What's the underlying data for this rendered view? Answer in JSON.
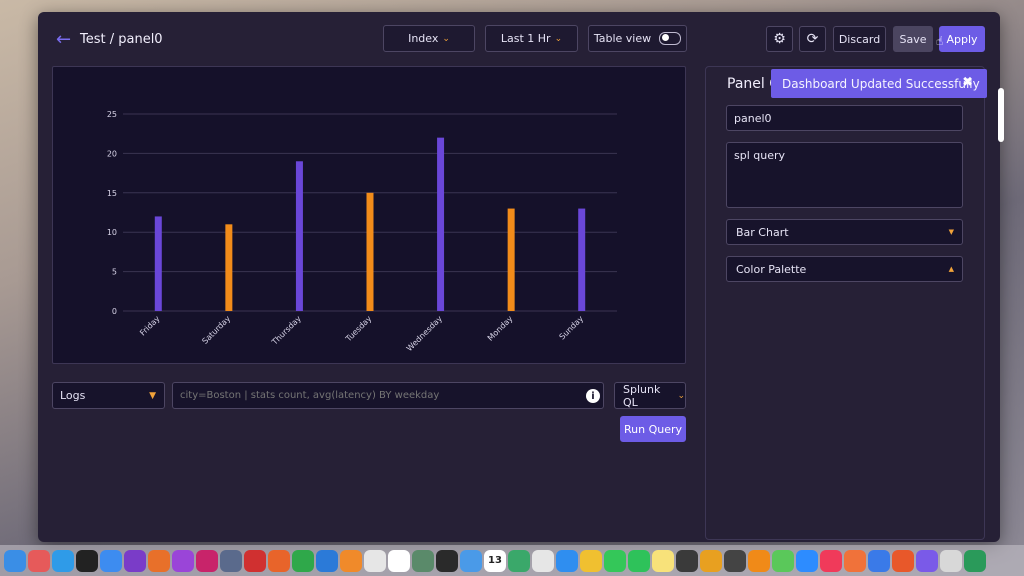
{
  "header": {
    "title": "Test / panel0",
    "index_label": "Index",
    "time_label": "Last 1 Hr",
    "table_view_label": "Table view",
    "discard_label": "Discard",
    "save_label": "Save",
    "apply_label": "Apply"
  },
  "chart_data": {
    "type": "bar",
    "categories": [
      "Friday",
      "Saturday",
      "Thursday",
      "Tuesday",
      "Wednesday",
      "Monday",
      "Sunday"
    ],
    "values": [
      12,
      11,
      19,
      15,
      22,
      13,
      13
    ],
    "bar_colors": [
      "#6a47d8",
      "#f28c1a",
      "#6a47d8",
      "#f28c1a",
      "#6a47d8",
      "#f28c1a",
      "#6a47d8"
    ],
    "yticks": [
      "0",
      "5",
      "10",
      "15",
      "20",
      "25"
    ],
    "ylim": [
      0,
      25
    ],
    "grid": true,
    "title": "",
    "xlabel": "",
    "ylabel": ""
  },
  "query": {
    "source_label": "Logs",
    "placeholder": "city=Boston | stats count, avg(latency) BY weekday",
    "language_label": "Splunk QL",
    "run_label": "Run Query"
  },
  "panel": {
    "title": "Panel C",
    "name_value": "panel0",
    "query_value": "spl query",
    "chart_type_label": "Bar Chart",
    "palette_label": "Color Palette"
  },
  "toast": {
    "message": "Dashboard Updated Successfully"
  },
  "dock": {
    "calendar_day": "13",
    "icons": [
      {
        "name": "finder-icon",
        "color": "#3a8ee6"
      },
      {
        "name": "launchpad-icon",
        "color": "#e65a5a"
      },
      {
        "name": "safari-icon",
        "color": "#2f9be8"
      },
      {
        "name": "appletv-icon",
        "color": "#222222"
      },
      {
        "name": "mail-icon",
        "color": "#3d8cf0"
      },
      {
        "name": "omnifocus-icon",
        "color": "#7a3cc8"
      },
      {
        "name": "jetbrains-icon",
        "color": "#e8702a"
      },
      {
        "name": "stacks-icon",
        "color": "#9a45d8"
      },
      {
        "name": "affinity-icon",
        "color": "#c8246a"
      },
      {
        "name": "disk-icon",
        "color": "#5a6a8c"
      },
      {
        "name": "redapp-icon",
        "color": "#d03030"
      },
      {
        "name": "draw-icon",
        "color": "#e8642a"
      },
      {
        "name": "numbers-icon",
        "color": "#2fa84a"
      },
      {
        "name": "keynote-icon",
        "color": "#2b7ad8"
      },
      {
        "name": "sublime-icon",
        "color": "#f08a2a"
      },
      {
        "name": "preview-icon",
        "color": "#e6e6e6"
      },
      {
        "name": "slack-icon",
        "color": "#ffffff"
      },
      {
        "name": "layers-icon",
        "color": "#5a8a6a"
      },
      {
        "name": "terminal-icon",
        "color": "#2a2a2a"
      },
      {
        "name": "finder2-icon",
        "color": "#4a9ae8"
      },
      {
        "name": "calendar-icon",
        "color": "#ffffff"
      },
      {
        "name": "android-icon",
        "color": "#3aa86a"
      },
      {
        "name": "cloud-icon",
        "color": "#e6e6e6"
      },
      {
        "name": "appstore-icon",
        "color": "#2f8ef0"
      },
      {
        "name": "photos-icon",
        "color": "#f0c030"
      },
      {
        "name": "messages-icon",
        "color": "#34c759"
      },
      {
        "name": "facetime-icon",
        "color": "#2ec25a"
      },
      {
        "name": "notes-icon",
        "color": "#f8e27a"
      },
      {
        "name": "audio-icon",
        "color": "#3a3a3a"
      },
      {
        "name": "plex-icon",
        "color": "#e8a020"
      },
      {
        "name": "obs-icon",
        "color": "#444444"
      },
      {
        "name": "vlc-icon",
        "color": "#f08a18"
      },
      {
        "name": "pycharm-icon",
        "color": "#5ac85a"
      },
      {
        "name": "zoom-icon",
        "color": "#2d8cff"
      },
      {
        "name": "music-icon",
        "color": "#f03a5a"
      },
      {
        "name": "swift-icon",
        "color": "#f0723a"
      },
      {
        "name": "xcode-icon",
        "color": "#3a7ae8"
      },
      {
        "name": "affinity2-icon",
        "color": "#e8582a"
      },
      {
        "name": "grid-icon",
        "color": "#7a5ae8"
      },
      {
        "name": "script-icon",
        "color": "#d8d8d8"
      },
      {
        "name": "excel-icon",
        "color": "#2a9a5a"
      }
    ]
  }
}
